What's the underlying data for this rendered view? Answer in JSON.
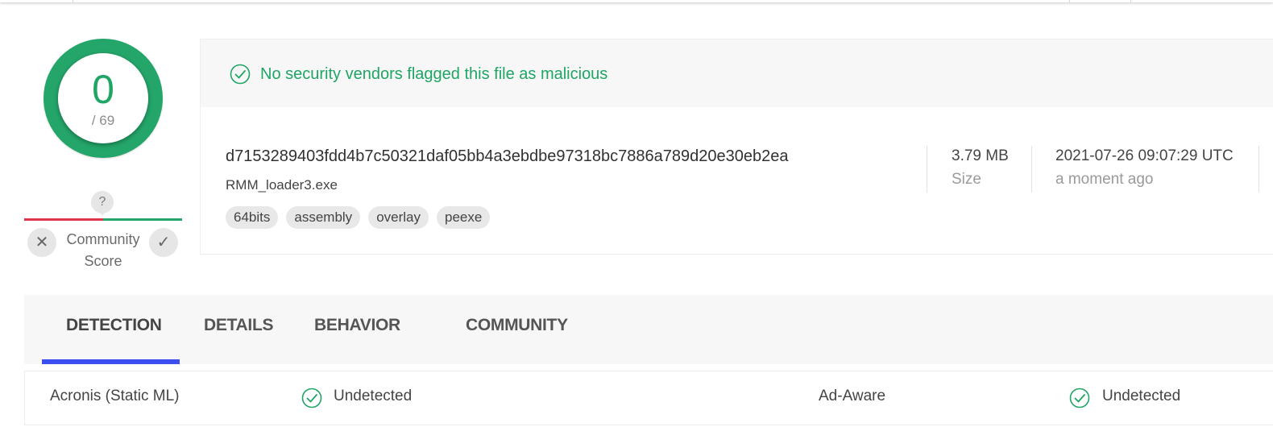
{
  "score": {
    "detected": "0",
    "total": "/ 69"
  },
  "community": {
    "unknown_glyph": "?",
    "label": "Community Score",
    "downvote_glyph": "✕",
    "upvote_glyph": "✓"
  },
  "banner": {
    "text": "No security vendors flagged this file as malicious",
    "icon": "check-circle-icon"
  },
  "file": {
    "hash": "d7153289403fdd4b7c50321daf05bb4a3ebdbe97318bc7886a789d20e30eb2ea",
    "name": "RMM_loader3.exe",
    "tags": [
      "64bits",
      "assembly",
      "overlay",
      "peexe"
    ],
    "size_value": "3.79 MB",
    "size_label": "Size",
    "date_value": "2021-07-26 09:07:29 UTC",
    "date_relative": "a moment ago"
  },
  "tabs": [
    "DETECTION",
    "DETAILS",
    "BEHAVIOR",
    "COMMUNITY"
  ],
  "detections": [
    {
      "engine": "Acronis (Static ML)",
      "result": "Undetected"
    },
    {
      "engine": "Ad-Aware",
      "result": "Undetected"
    }
  ],
  "colors": {
    "safe_green": "#1fa564",
    "ring_green": "#24a66a",
    "negative_red": "#e0334c",
    "tab_accent": "#3d4ef0"
  }
}
